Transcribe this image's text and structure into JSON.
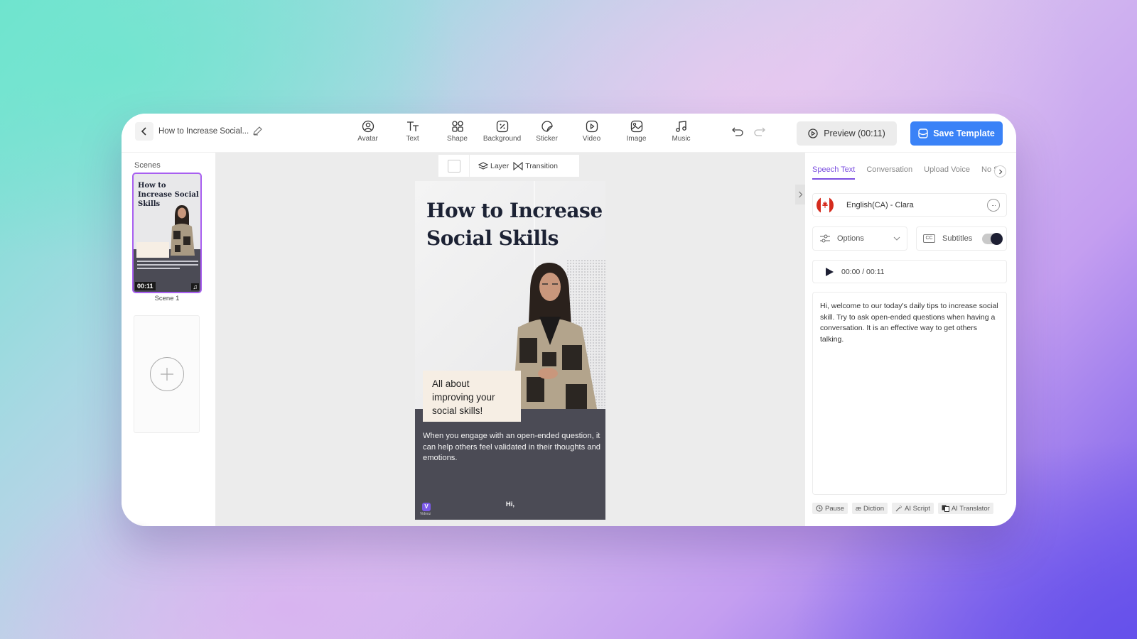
{
  "header": {
    "project_title": "How to Increase Social...",
    "tools": [
      {
        "label": "Avatar",
        "icon": "avatar-icon"
      },
      {
        "label": "Text",
        "icon": "text-icon"
      },
      {
        "label": "Shape",
        "icon": "shape-icon"
      },
      {
        "label": "Background",
        "icon": "background-icon"
      },
      {
        "label": "Sticker",
        "icon": "sticker-icon"
      },
      {
        "label": "Video",
        "icon": "video-icon"
      },
      {
        "label": "Image",
        "icon": "image-icon"
      },
      {
        "label": "Music",
        "icon": "music-icon"
      }
    ],
    "preview_label": "Preview (00:11)",
    "save_label": "Save Template",
    "accent_color": "#3a82f7"
  },
  "scenes": {
    "label": "Scenes",
    "items": [
      {
        "name": "Scene 1",
        "duration": "00:11",
        "thumb_title": "How to Increase Social Skills",
        "selected": true
      }
    ],
    "add_scene_icon": "plus-icon",
    "selected_color": "#a85ff0"
  },
  "canvas": {
    "toolbar": {
      "layer_label": "Layer",
      "transition_label": "Transition"
    },
    "video": {
      "title": "How to Increase Social Skills",
      "callout": "All about improving your social skills!",
      "body": "When you engage with an open-ended question, it can help others feel validated in their thoughts and emotions.",
      "caption": "Hi,",
      "logo_text": "Vidnoz"
    }
  },
  "right_panel": {
    "tabs": [
      "Speech Text",
      "Conversation",
      "Upload Voice",
      "No S"
    ],
    "active_tab": "Speech Text",
    "voice": "English(CA) - Clara",
    "options_label": "Options",
    "subtitles_label": "Subtitles",
    "subtitles_on": true,
    "player_time": "00:00 / 00:11",
    "script": "Hi, welcome to our today's daily tips to increase social skill. Try to ask open-ended questions when having a conversation. It is an effective way to get others talking.",
    "bottom_tools": [
      "Pause",
      "Diction",
      "AI Script",
      "AI Translator"
    ],
    "tab_accent": "#7b4ee0"
  }
}
